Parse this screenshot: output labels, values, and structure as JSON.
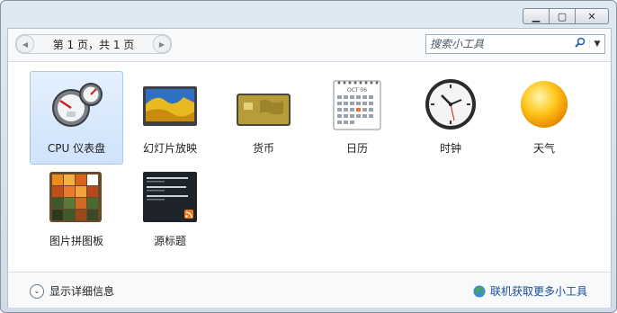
{
  "window": {
    "minimize_glyph": "▁",
    "maximize_glyph": "▢",
    "close_glyph": "✕"
  },
  "toolbar": {
    "page_label": "第 1 页，共 1 页",
    "prev_icon": "◀",
    "next_icon": "▶",
    "search_placeholder": "搜索小工具",
    "search_icon": "⚲",
    "dropdown_icon": "▼"
  },
  "gadgets": [
    {
      "label": "CPU 仪表盘",
      "icon": "cpu-meter-icon",
      "selected": true
    },
    {
      "label": "幻灯片放映",
      "icon": "slideshow-icon",
      "selected": false
    },
    {
      "label": "货币",
      "icon": "currency-icon",
      "selected": false
    },
    {
      "label": "日历",
      "icon": "calendar-icon",
      "selected": false
    },
    {
      "label": "时钟",
      "icon": "clock-icon",
      "selected": false
    },
    {
      "label": "天气",
      "icon": "weather-icon",
      "selected": false
    },
    {
      "label": "图片拼图板",
      "icon": "picture-puzzle-icon",
      "selected": false
    },
    {
      "label": "源标题",
      "icon": "feed-headlines-icon",
      "selected": false
    }
  ],
  "calendar_icon": {
    "month": "OCT 06"
  },
  "footer": {
    "show_details_label": "显示详细信息",
    "get_more_label": "联机获取更多小工具",
    "chevron_icon": "⌄"
  }
}
